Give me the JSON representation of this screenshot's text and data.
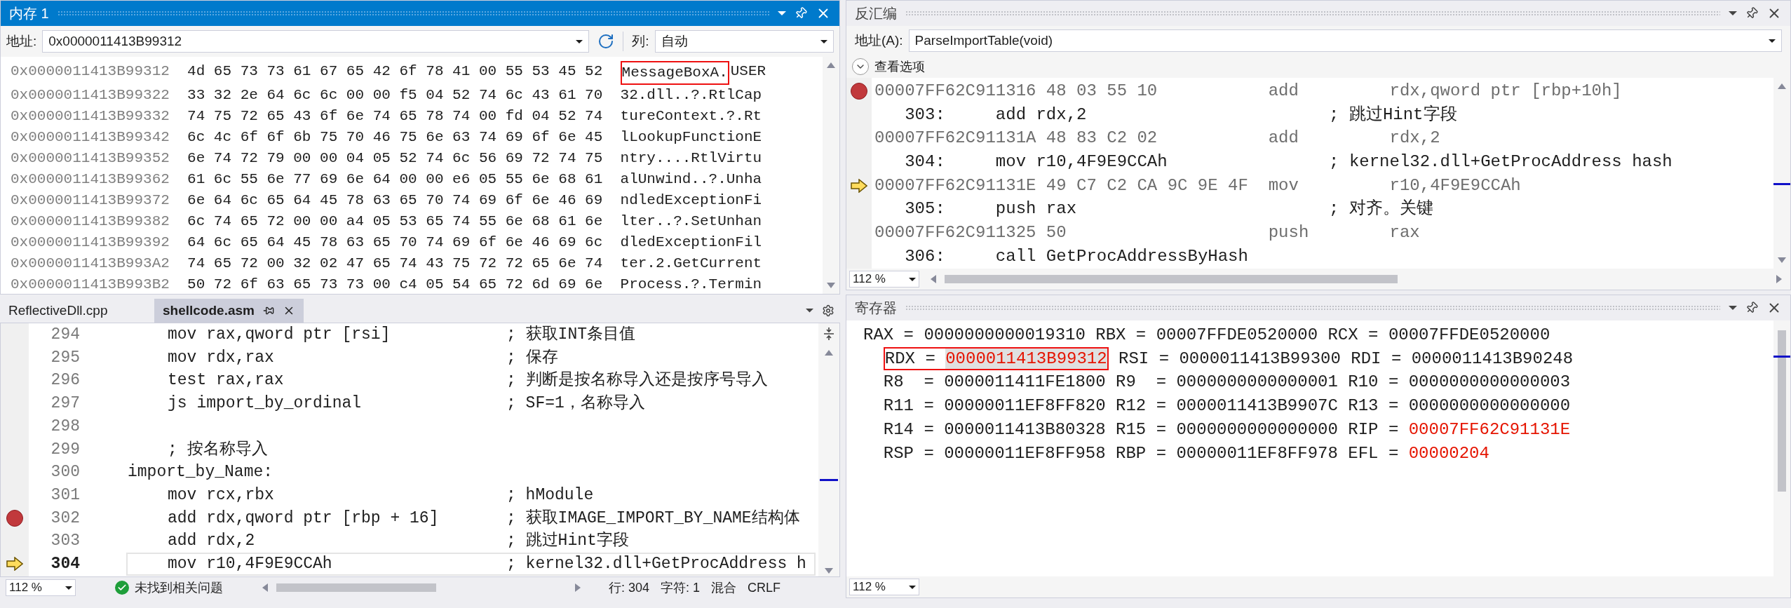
{
  "memory": {
    "title": "内存 1",
    "active": true,
    "address_label": "地址:",
    "address": "0x0000011413B99312",
    "columns_label": "列:",
    "columns_value": "自动",
    "rows": [
      {
        "address": "0x0000011413B99312",
        "hex": "4d 65 73 73 61 67 65 42 6f 78 41 00 55 53 45 52",
        "ascii": [
          {
            "text": "MessageBoxA.",
            "boxed": true
          },
          {
            "text": "USER",
            "boxed": false
          }
        ]
      },
      {
        "address": "0x0000011413B99322",
        "hex": "33 32 2e 64 6c 6c 00 00 f5 04 52 74 6c 43 61 70",
        "ascii": [
          {
            "text": "32.dll..?.RtlCap",
            "boxed": false
          }
        ]
      },
      {
        "address": "0x0000011413B99332",
        "hex": "74 75 72 65 43 6f 6e 74 65 78 74 00 fd 04 52 74",
        "ascii": [
          {
            "text": "tureContext.?.Rt",
            "boxed": false
          }
        ]
      },
      {
        "address": "0x0000011413B99342",
        "hex": "6c 4c 6f 6f 6b 75 70 46 75 6e 63 74 69 6f 6e 45",
        "ascii": [
          {
            "text": "lLookupFunctionE",
            "boxed": false
          }
        ]
      },
      {
        "address": "0x0000011413B99352",
        "hex": "6e 74 72 79 00 00 04 05 52 74 6c 56 69 72 74 75",
        "ascii": [
          {
            "text": "ntry....RtlVirtu",
            "boxed": false
          }
        ]
      },
      {
        "address": "0x0000011413B99362",
        "hex": "61 6c 55 6e 77 69 6e 64 00 00 e6 05 55 6e 68 61",
        "ascii": [
          {
            "text": "alUnwind..?.Unha",
            "boxed": false
          }
        ]
      },
      {
        "address": "0x0000011413B99372",
        "hex": "6e 64 6c 65 64 45 78 63 65 70 74 69 6f 6e 46 69",
        "ascii": [
          {
            "text": "ndledExceptionFi",
            "boxed": false
          }
        ]
      },
      {
        "address": "0x0000011413B99382",
        "hex": "6c 74 65 72 00 00 a4 05 53 65 74 55 6e 68 61 6e",
        "ascii": [
          {
            "text": "lter..?.SetUnhan",
            "boxed": false
          }
        ]
      },
      {
        "address": "0x0000011413B99392",
        "hex": "64 6c 65 64 45 78 63 65 70 74 69 6f 6e 46 69 6c",
        "ascii": [
          {
            "text": "dledExceptionFil",
            "boxed": false
          }
        ]
      },
      {
        "address": "0x0000011413B993A2",
        "hex": "74 65 72 00 32 02 47 65 74 43 75 72 72 65 6e 74",
        "ascii": [
          {
            "text": "ter.2.GetCurrent",
            "boxed": false
          }
        ]
      },
      {
        "address": "0x0000011413B993B2",
        "hex": "50 72 6f 63 65 73 73 00 c4 05 54 65 72 6d 69 6e",
        "ascii": [
          {
            "text": "Process.?.Termin",
            "boxed": false
          }
        ]
      }
    ]
  },
  "editor": {
    "tabs": [
      {
        "label": "ReflectiveDll.cpp",
        "selected": false
      },
      {
        "label": "shellcode.asm",
        "selected": true
      }
    ],
    "lines": [
      {
        "number": "294",
        "kind": "instruction",
        "code": "mov rax,qword ptr [rsi]",
        "comment": "; 获取INT条目值",
        "breakpoint": false,
        "current": false
      },
      {
        "number": "295",
        "kind": "instruction",
        "code": "mov rdx,rax",
        "comment": "; 保存",
        "breakpoint": false,
        "current": false
      },
      {
        "number": "296",
        "kind": "instruction",
        "code": "test rax,rax",
        "comment": "; 判断是按名称导入还是按序号导入",
        "breakpoint": false,
        "current": false
      },
      {
        "number": "297",
        "kind": "instruction",
        "code": "js import_by_ordinal",
        "comment": "; SF=1，名称导入",
        "breakpoint": false,
        "current": false
      },
      {
        "number": "298",
        "kind": "instruction",
        "breakpoint": false,
        "current": false
      },
      {
        "number": "299",
        "kind": "instruction",
        "code": "; 按名称导入",
        "breakpoint": false,
        "current": false
      },
      {
        "number": "300",
        "kind": "label",
        "code": "import_by_Name:",
        "breakpoint": false,
        "current": false
      },
      {
        "number": "301",
        "kind": "instruction",
        "code": "mov rcx,rbx",
        "comment": "; hModule",
        "breakpoint": false,
        "current": false
      },
      {
        "number": "302",
        "kind": "instruction",
        "code": "add rdx,qword ptr [rbp + 16]",
        "comment": "; 获取IMAGE_IMPORT_BY_NAME结构体",
        "breakpoint": true,
        "current": false
      },
      {
        "number": "303",
        "kind": "instruction",
        "code": "add rdx,2",
        "comment": "; 跳过Hint字段",
        "breakpoint": false,
        "current": false
      },
      {
        "number": "304",
        "kind": "instruction",
        "code": "mov r10,4F9E9CCAh",
        "comment": "; kernel32.dll+GetProcAddress h",
        "breakpoint": false,
        "current": true
      }
    ],
    "status": {
      "zoom": "112 %",
      "issues": "未找到相关问题",
      "line": "行: 304",
      "char": "字符: 1",
      "mode": "混合",
      "eol": "CRLF"
    }
  },
  "disassembly": {
    "title": "反汇编",
    "active": false,
    "address_label": "地址(A):",
    "address": "ParseImportTable(void)",
    "options": "查看选项",
    "zoom": "112 %",
    "lines": [
      {
        "kind": "instruction",
        "address": "00007FF62C911316",
        "bytes": "48 03 55 10",
        "mnemonic": "add",
        "operands": "rdx,qword ptr [rbp+10h]",
        "breakpoint": true,
        "current": false
      },
      {
        "kind": "source",
        "number": "303:",
        "code": "add rdx,2",
        "comment": "; 跳过Hint字段",
        "breakpoint": false,
        "current": false
      },
      {
        "kind": "instruction",
        "address": "00007FF62C91131A",
        "bytes": "48 83 C2 02",
        "mnemonic": "add",
        "operands": "rdx,2",
        "breakpoint": false,
        "current": false
      },
      {
        "kind": "source",
        "number": "304:",
        "code": "mov r10,4F9E9CCAh",
        "comment": "; kernel32.dll+GetProcAddress hash",
        "breakpoint": false,
        "current": false
      },
      {
        "kind": "instruction",
        "address": "00007FF62C91131E",
        "bytes": "49 C7 C2 CA 9C 9E 4F",
        "mnemonic": "mov",
        "operands": "r10,4F9E9CCAh",
        "breakpoint": false,
        "current": true
      },
      {
        "kind": "source",
        "number": "305:",
        "code": "push rax",
        "comment": "; 对齐。关键",
        "breakpoint": false,
        "current": false
      },
      {
        "kind": "instruction",
        "address": "00007FF62C911325",
        "bytes": "50",
        "mnemonic": "push",
        "operands": "rax",
        "breakpoint": false,
        "current": false
      },
      {
        "kind": "source",
        "number": "306:",
        "code": "call GetProcAddressByHash",
        "breakpoint": false,
        "current": false
      }
    ]
  },
  "registers": {
    "title": "寄存器",
    "active": false,
    "zoom": "112 %",
    "rows": [
      [
        {
          "label": "RAX =",
          "value": "0000000000019310",
          "changed": false,
          "selected": false,
          "boxed": false
        },
        {
          "label": "RBX =",
          "value": "00007FFDE0520000",
          "changed": false,
          "selected": false,
          "boxed": false
        },
        {
          "label": "RCX =",
          "value": "00007FFDE0520000",
          "changed": false,
          "selected": false,
          "boxed": false
        }
      ],
      [
        {
          "label": "RDX =",
          "value": "0000011413B99312",
          "changed": true,
          "selected": true,
          "boxed": true
        },
        {
          "label": "RSI =",
          "value": "0000011413B99300",
          "changed": false,
          "selected": false,
          "boxed": false
        },
        {
          "label": "RDI =",
          "value": "0000011413B90248",
          "changed": false,
          "selected": false,
          "boxed": false
        }
      ],
      [
        {
          "label": "R8  =",
          "value": "0000011411FE1800",
          "changed": false,
          "selected": false,
          "boxed": false
        },
        {
          "label": "R9  =",
          "value": "0000000000000001",
          "changed": false,
          "selected": false,
          "boxed": false
        },
        {
          "label": "R10 =",
          "value": "0000000000000003",
          "changed": false,
          "selected": false,
          "boxed": false
        }
      ],
      [
        {
          "label": "R11 =",
          "value": "00000011EF8FF820",
          "changed": false,
          "selected": false,
          "boxed": false
        },
        {
          "label": "R12 =",
          "value": "0000011413B9907C",
          "changed": false,
          "selected": false,
          "boxed": false
        },
        {
          "label": "R13 =",
          "value": "0000000000000000",
          "changed": false,
          "selected": false,
          "boxed": false
        }
      ],
      [
        {
          "label": "R14 =",
          "value": "0000011413B80328",
          "changed": false,
          "selected": false,
          "boxed": false
        },
        {
          "label": "R15 =",
          "value": "0000000000000000",
          "changed": false,
          "selected": false,
          "boxed": false
        },
        {
          "label": "RIP =",
          "value": "00007FF62C91131E",
          "changed": true,
          "selected": false,
          "boxed": false
        }
      ],
      [
        {
          "label": "RSP =",
          "value": "00000011EF8FF958",
          "changed": false,
          "selected": false,
          "boxed": false
        },
        {
          "label": "RBP =",
          "value": "00000011EF8FF978",
          "changed": false,
          "selected": false,
          "boxed": false
        },
        {
          "label": "EFL =",
          "value": "00000204",
          "changed": true,
          "selected": false,
          "boxed": false
        }
      ]
    ]
  }
}
